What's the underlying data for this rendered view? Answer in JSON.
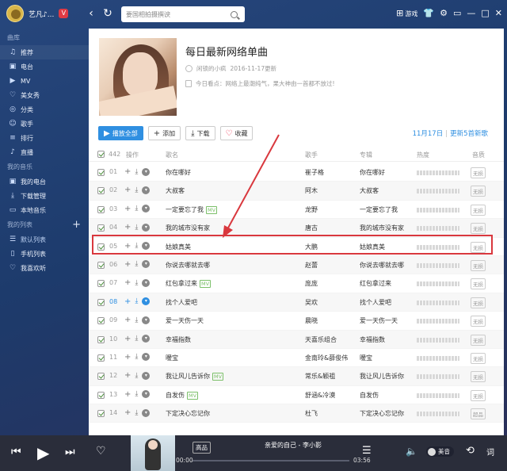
{
  "window": {
    "user_name": "艺凡♪...",
    "vip_badge": "V",
    "search_placeholder": "要国相拍摄撰谀",
    "game_label": "游戏"
  },
  "sidebar": {
    "sections": [
      {
        "title": "曲库",
        "items": [
          {
            "label": "推荐",
            "icon": "music-note-icon",
            "active": true
          },
          {
            "label": "电台",
            "icon": "radio-icon"
          },
          {
            "label": "MV",
            "icon": "mv-icon"
          },
          {
            "label": "美女秀",
            "icon": "heart-icon"
          },
          {
            "label": "分类",
            "icon": "category-icon"
          },
          {
            "label": "歌手",
            "icon": "singer-icon"
          },
          {
            "label": "排行",
            "icon": "chart-icon"
          },
          {
            "label": "直播",
            "icon": "mic-icon"
          }
        ]
      },
      {
        "title": "我的音乐",
        "items": [
          {
            "label": "我的电台",
            "icon": "radio-icon"
          },
          {
            "label": "下载管理",
            "icon": "download-icon"
          },
          {
            "label": "本地音乐",
            "icon": "monitor-icon"
          }
        ]
      },
      {
        "title": "我的列表",
        "items": [
          {
            "label": "默认列表",
            "icon": "list-icon"
          },
          {
            "label": "手机列表",
            "icon": "phone-icon"
          },
          {
            "label": "我喜欢听",
            "icon": "heart-icon"
          }
        ]
      }
    ]
  },
  "playlist": {
    "title": "每日最新网络单曲",
    "author": "闲锁的小疯",
    "date": "2016-11-17更新",
    "description": "今日看点：网络上最潮纯气，果大神由一首都不放过!",
    "buttons": {
      "play_all": "播放全部",
      "add": "添加",
      "download": "下载",
      "favorite": "收藏"
    },
    "update_date": "11月17日",
    "update_count": "更新5首新歌"
  },
  "table": {
    "count": "442",
    "headers": {
      "ops": "操作",
      "title": "歌名",
      "artist": "歌手",
      "album": "专辑",
      "popularity": "热度",
      "quality": "音质"
    },
    "rows": [
      {
        "num": "01",
        "title": "你在哪好",
        "mv": "",
        "artist": "崔子格",
        "album": "你在哪好",
        "quality": "无损"
      },
      {
        "num": "02",
        "title": "大叔客",
        "mv": "",
        "artist": "阿木",
        "album": "大叔客",
        "quality": "无损"
      },
      {
        "num": "03",
        "title": "一定要忘了我",
        "mv": "MV",
        "artist": "龙野",
        "album": "一定要忘了我",
        "quality": "无损"
      },
      {
        "num": "04",
        "title": "我的城市没有家",
        "mv": "",
        "artist": "唐古",
        "album": "我的城市没有家",
        "quality": "无损"
      },
      {
        "num": "05",
        "title": "姑娘真美",
        "mv": "",
        "artist": "大鹏",
        "album": "姑娘真美",
        "quality": "无损"
      },
      {
        "num": "06",
        "title": "你说去哪就去哪",
        "mv": "",
        "artist": "赵蕾",
        "album": "你说去哪就去哪",
        "quality": "无损"
      },
      {
        "num": "07",
        "title": "红包拿过来",
        "mv": "MV",
        "artist": "庞庞",
        "album": "红包拿过来",
        "quality": "无损"
      },
      {
        "num": "08",
        "title": "找个人爱吧",
        "mv": "",
        "artist": "吴欢",
        "album": "找个人爱吧",
        "quality": "无损",
        "playing": true
      },
      {
        "num": "09",
        "title": "爱一天伤一天",
        "mv": "",
        "artist": "晨晓",
        "album": "爱一天伤一天",
        "quality": "无损"
      },
      {
        "num": "10",
        "title": "幸福指数",
        "mv": "",
        "artist": "天喜乐组合",
        "album": "幸福指数",
        "quality": "无损"
      },
      {
        "num": "11",
        "title": "暧宝",
        "mv": "",
        "artist": "金南玲&薛俊伟",
        "album": "暧宝",
        "quality": "无损"
      },
      {
        "num": "12",
        "title": "我让风儿告诉你",
        "mv": "MV",
        "artist": "常乐&颖祖",
        "album": "我让风儿告诉你",
        "quality": "无损"
      },
      {
        "num": "13",
        "title": "自发伤",
        "mv": "MV",
        "artist": "舒涵&冷漠",
        "album": "自发伤",
        "quality": "无损"
      },
      {
        "num": "14",
        "title": "下定决心忘记你",
        "mv": "",
        "artist": "杜飞",
        "album": "下定决心忘记你",
        "quality": "超品"
      }
    ]
  },
  "player": {
    "quality": "高品",
    "now_playing": "亲爱的自己 - 李小影",
    "time_current": "00:00",
    "time_total": "03:56",
    "progress": 0.0,
    "effect_label": "美音"
  },
  "colors": {
    "accent": "#2f8fe1",
    "highlight_box": "#d9383e",
    "sidebar_bg": "#1e3d6e",
    "player_bg": "#2a2d3a"
  }
}
